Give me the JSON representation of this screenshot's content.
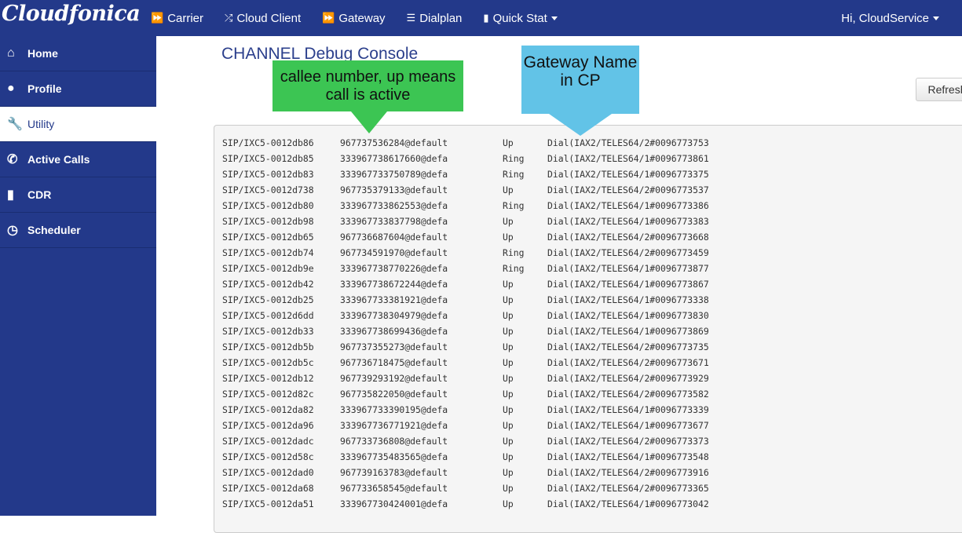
{
  "brand": "Cloudfonica",
  "nav": [
    {
      "label": "Carrier",
      "icon": "double-chevron-right-icon"
    },
    {
      "label": "Cloud Client",
      "icon": "shuffle-icon"
    },
    {
      "label": "Gateway",
      "icon": "double-chevron-right-icon"
    },
    {
      "label": "Dialplan",
      "icon": "list-icon"
    },
    {
      "label": "Quick Stat",
      "icon": "book-icon"
    }
  ],
  "user": "Hi, CloudService",
  "sidebar": [
    {
      "label": "Home",
      "icon": "home-icon"
    },
    {
      "label": "Profile",
      "icon": "user-icon"
    },
    {
      "label": "Utility",
      "icon": "wrench-icon",
      "active": true
    },
    {
      "label": "Active Calls",
      "icon": "phone-icon"
    },
    {
      "label": "CDR",
      "icon": "book-icon"
    },
    {
      "label": "Scheduler",
      "icon": "clock-icon"
    }
  ],
  "page_title": "CHANNEL Debug Console",
  "refresh_label": "Refresh",
  "annotations": {
    "green": "callee number, up means call is active",
    "blue": "Gateway Name in CP"
  },
  "rows": [
    [
      "SIP/IXC5-0012db86",
      "967737536284@default",
      "Up",
      "Dial(IAX2/TELES64/2#0096773753"
    ],
    [
      "SIP/IXC5-0012db85",
      "333967738617660@defa",
      "Ring",
      "Dial(IAX2/TELES64/1#0096773861"
    ],
    [
      "SIP/IXC5-0012db83",
      "333967733750789@defa",
      "Ring",
      "Dial(IAX2/TELES64/1#0096773375"
    ],
    [
      "SIP/IXC5-0012d738",
      "967735379133@default",
      "Up",
      "Dial(IAX2/TELES64/2#0096773537"
    ],
    [
      "SIP/IXC5-0012db80",
      "333967733862553@defa",
      "Ring",
      "Dial(IAX2/TELES64/1#0096773386"
    ],
    [
      "SIP/IXC5-0012db98",
      "333967733837798@defa",
      "Up",
      "Dial(IAX2/TELES64/1#0096773383"
    ],
    [
      "SIP/IXC5-0012db65",
      "967736687604@default",
      "Up",
      "Dial(IAX2/TELES64/2#0096773668"
    ],
    [
      "SIP/IXC5-0012db74",
      "967734591970@default",
      "Ring",
      "Dial(IAX2/TELES64/2#0096773459"
    ],
    [
      "SIP/IXC5-0012db9e",
      "333967738770226@defa",
      "Ring",
      "Dial(IAX2/TELES64/1#0096773877"
    ],
    [
      "SIP/IXC5-0012db42",
      "333967738672244@defa",
      "Up",
      "Dial(IAX2/TELES64/1#0096773867"
    ],
    [
      "SIP/IXC5-0012db25",
      "333967733381921@defa",
      "Up",
      "Dial(IAX2/TELES64/1#0096773338"
    ],
    [
      "SIP/IXC5-0012d6dd",
      "333967738304979@defa",
      "Up",
      "Dial(IAX2/TELES64/1#0096773830"
    ],
    [
      "SIP/IXC5-0012db33",
      "333967738699436@defa",
      "Up",
      "Dial(IAX2/TELES64/1#0096773869"
    ],
    [
      "SIP/IXC5-0012db5b",
      "967737355273@default",
      "Up",
      "Dial(IAX2/TELES64/2#0096773735"
    ],
    [
      "SIP/IXC5-0012db5c",
      "967736718475@default",
      "Up",
      "Dial(IAX2/TELES64/2#0096773671"
    ],
    [
      "SIP/IXC5-0012db12",
      "967739293192@default",
      "Up",
      "Dial(IAX2/TELES64/2#0096773929"
    ],
    [
      "SIP/IXC5-0012d82c",
      "967735822050@default",
      "Up",
      "Dial(IAX2/TELES64/2#0096773582"
    ],
    [
      "SIP/IXC5-0012da82",
      "333967733390195@defa",
      "Up",
      "Dial(IAX2/TELES64/1#0096773339"
    ],
    [
      "SIP/IXC5-0012da96",
      "333967736771921@defa",
      "Up",
      "Dial(IAX2/TELES64/1#0096773677"
    ],
    [
      "SIP/IXC5-0012dadc",
      "967733736808@default",
      "Up",
      "Dial(IAX2/TELES64/2#0096773373"
    ],
    [
      "SIP/IXC5-0012d58c",
      "333967735483565@defa",
      "Up",
      "Dial(IAX2/TELES64/1#0096773548"
    ],
    [
      "SIP/IXC5-0012dad0",
      "967739163783@default",
      "Up",
      "Dial(IAX2/TELES64/2#0096773916"
    ],
    [
      "SIP/IXC5-0012da68",
      "967733658545@default",
      "Up",
      "Dial(IAX2/TELES64/2#0096773365"
    ],
    [
      "SIP/IXC5-0012da51",
      "333967730424001@defa",
      "Up",
      "Dial(IAX2/TELES64/1#0096773042"
    ]
  ]
}
